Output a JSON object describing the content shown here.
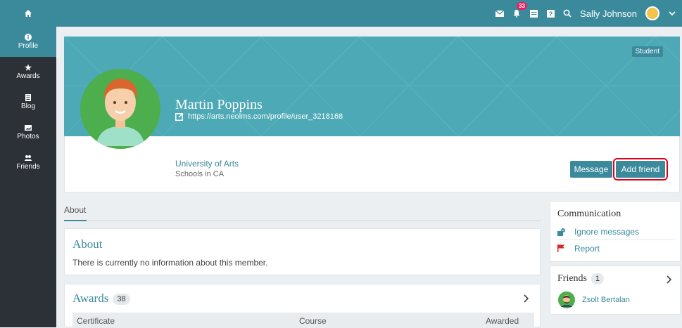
{
  "topbar": {
    "notification_count": "33",
    "user_name": "Sally Johnson"
  },
  "sidebar": {
    "items": [
      {
        "label": "Profile"
      },
      {
        "label": "Awards"
      },
      {
        "label": "Blog"
      },
      {
        "label": "Photos"
      },
      {
        "label": "Friends"
      }
    ]
  },
  "profile": {
    "role_badge": "Student",
    "name": "Martin Poppins",
    "url": "https://arts.neolms.com/profile/user_3218168",
    "organization": "University of Arts",
    "organization_sub": "Schools in CA",
    "message_label": "Message",
    "add_friend_label": "Add friend"
  },
  "tabs": {
    "about": "About"
  },
  "about": {
    "title": "About",
    "text": "There is currently no information about this member."
  },
  "awards": {
    "title": "Awards",
    "count": "38",
    "columns": [
      "Certificate",
      "Course",
      "Awarded"
    ]
  },
  "communication": {
    "title": "Communication",
    "ignore": "Ignore messages",
    "report": "Report"
  },
  "friends": {
    "title": "Friends",
    "count": "1",
    "items": [
      {
        "name": "Zsolt Bertalan"
      }
    ]
  },
  "colors": {
    "primary": "#3a8a9c",
    "banner": "#4da9b5",
    "sidebar": "#2b3137",
    "highlight": "#e0001a"
  }
}
